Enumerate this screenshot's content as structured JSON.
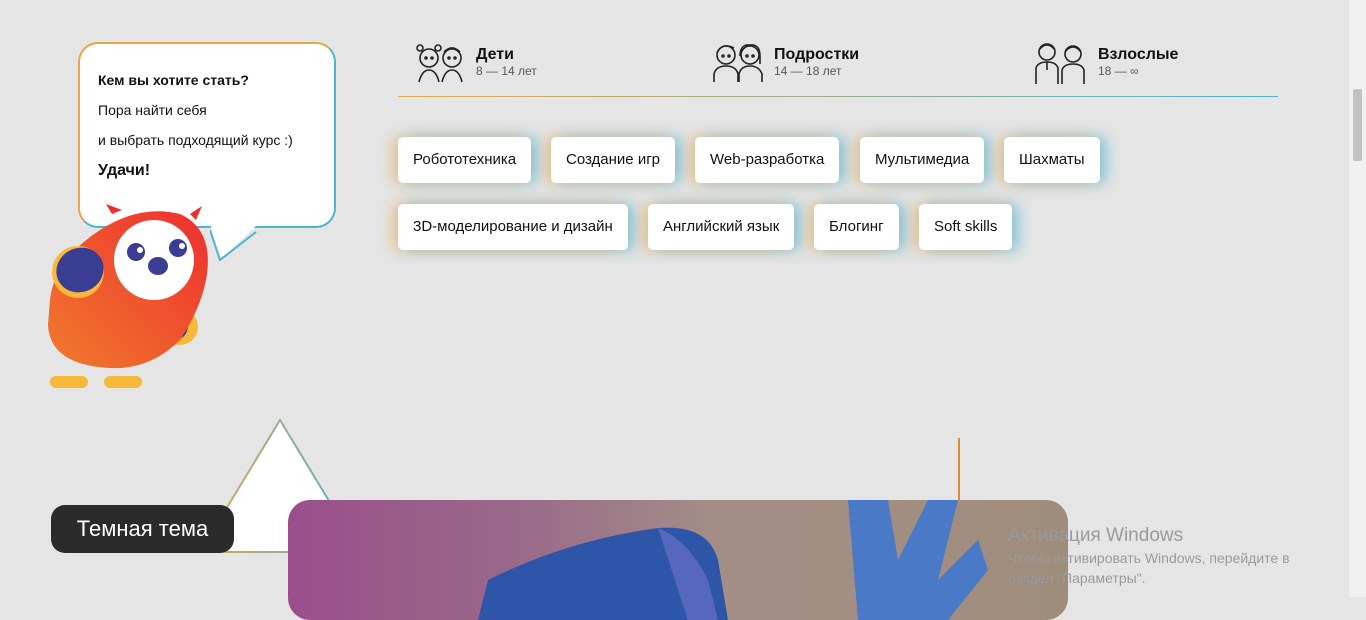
{
  "bubble": {
    "question": "Кем вы хотите стать?",
    "line1": "Пора найти себя",
    "line2": "и выбрать подходящий курс :)",
    "luck": "Удачи!"
  },
  "age_tabs": [
    {
      "name": "Дети",
      "range": "8 — 14 лет",
      "icon": "kids-icon"
    },
    {
      "name": "Подростки",
      "range": "14 — 18 лет",
      "icon": "teens-icon"
    },
    {
      "name": "Взлослые",
      "range": "18 — ∞",
      "icon": "adults-icon"
    }
  ],
  "courses": [
    "Робототехника",
    "Создание игр",
    "Web-разработка",
    "Мультимедиа",
    "Шахматы",
    "3D-моделирование и дизайн",
    "Английский язык",
    "Блогинг",
    "Soft skills"
  ],
  "dark_theme_button": "Темная тема",
  "activation": {
    "title": "Активация Windows",
    "text": "Чтобы активировать Windows, перейдите в раздел \"Параметры\"."
  },
  "colors": {
    "orange": "#e5a64a",
    "blue": "#4bb3d4",
    "owl_red": "#ee3b2e",
    "owl_navy": "#3a3d94",
    "owl_yellow": "#f8b83a"
  }
}
